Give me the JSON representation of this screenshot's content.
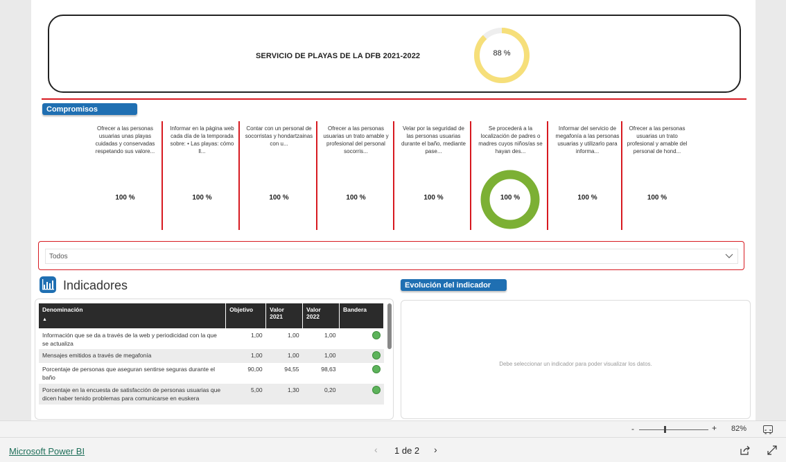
{
  "header": {
    "title": "SERVICIO DE PLAYAS DE LA DFB 2021-2022",
    "gauge_value": 0.88,
    "gauge_label": "88 %"
  },
  "compromisos": {
    "title": "Compromisos",
    "items": [
      {
        "text": "Ofrecer a las personas usuarias unas playas cuidadas y conservadas respetando sus valore...",
        "value": "100 %"
      },
      {
        "text": "Informar en la página web cada día de la temporada sobre: • Las playas: cómo ll...",
        "value": "100 %"
      },
      {
        "text": "Contar con un personal de socorristas y hondartzainas con u...",
        "value": "100 %"
      },
      {
        "text": "Ofrecer a las personas usuarias un trato amable y profesional del personal socorris...",
        "value": "100 %"
      },
      {
        "text": "Velar por la seguridad de las personas usuarias durante el baño, mediante pase...",
        "value": "100 %"
      },
      {
        "text": "Se procederá a la localización de padres o madres cuyos niños/as se hayan des...",
        "value": "100 %"
      },
      {
        "text": "Informar del servicio de megafonía a las personas usuarias y utilizarlo para informa...",
        "value": "100 %"
      },
      {
        "text": "Ofrecer a las personas usuarias un trato profesional y amable del personal de hond...",
        "value": "100 %"
      }
    ]
  },
  "slicer": {
    "value": "Todos"
  },
  "indicadores": {
    "title": "Indicadores",
    "columns": [
      "Denominación",
      "Objetivo",
      "Valor 2021",
      "Valor 2022",
      "Bandera"
    ],
    "col_valor2021_l1": "Valor",
    "col_valor2021_l2": "2021",
    "col_valor2022_l1": "Valor",
    "col_valor2022_l2": "2022",
    "sort_indicator": "▲",
    "rows": [
      {
        "name": "Información que se da a través de la web y periodicidad con la que se actualiza",
        "objetivo": "1,00",
        "v2021": "1,00",
        "v2022": "1,00"
      },
      {
        "name": "Mensajes emitidos a través de megafonía",
        "objetivo": "1,00",
        "v2021": "1,00",
        "v2022": "1,00"
      },
      {
        "name": "Porcentaje de personas que aseguran sentirse seguras durante el baño",
        "objetivo": "90,00",
        "v2021": "94,55",
        "v2022": "98,63"
      },
      {
        "name": "Porcentaje en la encuesta de satisfacción de personas usuarias que dicen haber tenido problemas para comunicarse en euskera",
        "objetivo": "5,00",
        "v2021": "1,30",
        "v2022": "0,20"
      }
    ]
  },
  "evolucion": {
    "title": "Evolución del indicador",
    "message": "Debe seleccionar un indicador para poder visualizar los datos."
  },
  "zoom": {
    "minus": "-",
    "plus": "+",
    "level": "82%",
    "value": 0.37
  },
  "footer": {
    "brand": "Microsoft Power BI",
    "page_label": "1 de 2",
    "prev": "‹",
    "next": "›"
  },
  "colors": {
    "accent_red": "#d71920",
    "pill_blue": "#1f6fb2",
    "gauge_yellow": "#f6df7a",
    "donut_green": "#7cb034",
    "flag_green": "#5db35b"
  },
  "icons": {
    "indicadores": "bar-chart-icon",
    "chevron": "chevron-down-icon",
    "share": "share-icon",
    "expand": "expand-icon",
    "fit": "fit-to-page-icon"
  }
}
